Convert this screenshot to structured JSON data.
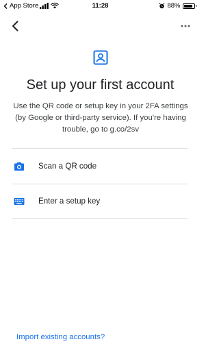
{
  "status_bar": {
    "carrier": "App Store",
    "time": "11:28",
    "battery_percent": "88%",
    "battery_level": 0.88
  },
  "header": {
    "back_icon": "chevron-left-icon",
    "more_icon": "more-horizontal-icon"
  },
  "hero": {
    "icon": "account-box-icon",
    "title": "Set up your first account",
    "description": "Use the QR code or setup key in your 2FA settings (by Google or third-party service). If you're having trouble, go to g.co/2sv"
  },
  "options": [
    {
      "label": "Scan a QR code",
      "icon": "camera-icon"
    },
    {
      "label": "Enter a setup key",
      "icon": "keyboard-icon"
    }
  ],
  "footer": {
    "import_label": "Import existing accounts?"
  },
  "colors": {
    "accent": "#1a73e8",
    "divider": "#dadce0",
    "text": "#202124"
  }
}
